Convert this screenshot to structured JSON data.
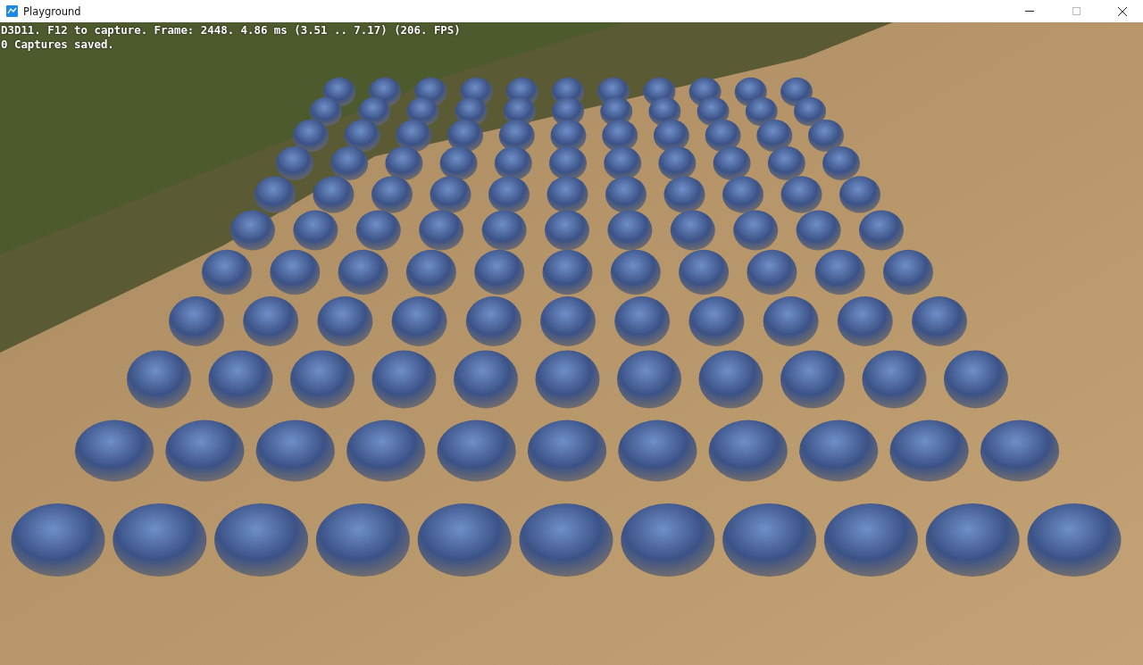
{
  "window": {
    "title": "Playground"
  },
  "overlay": [
    "D3D11. F12 to capture. Frame: 2448. 4.86 ms (3.51 .. 7.17) (206. FPS)",
    "0 Captures saved."
  ]
}
